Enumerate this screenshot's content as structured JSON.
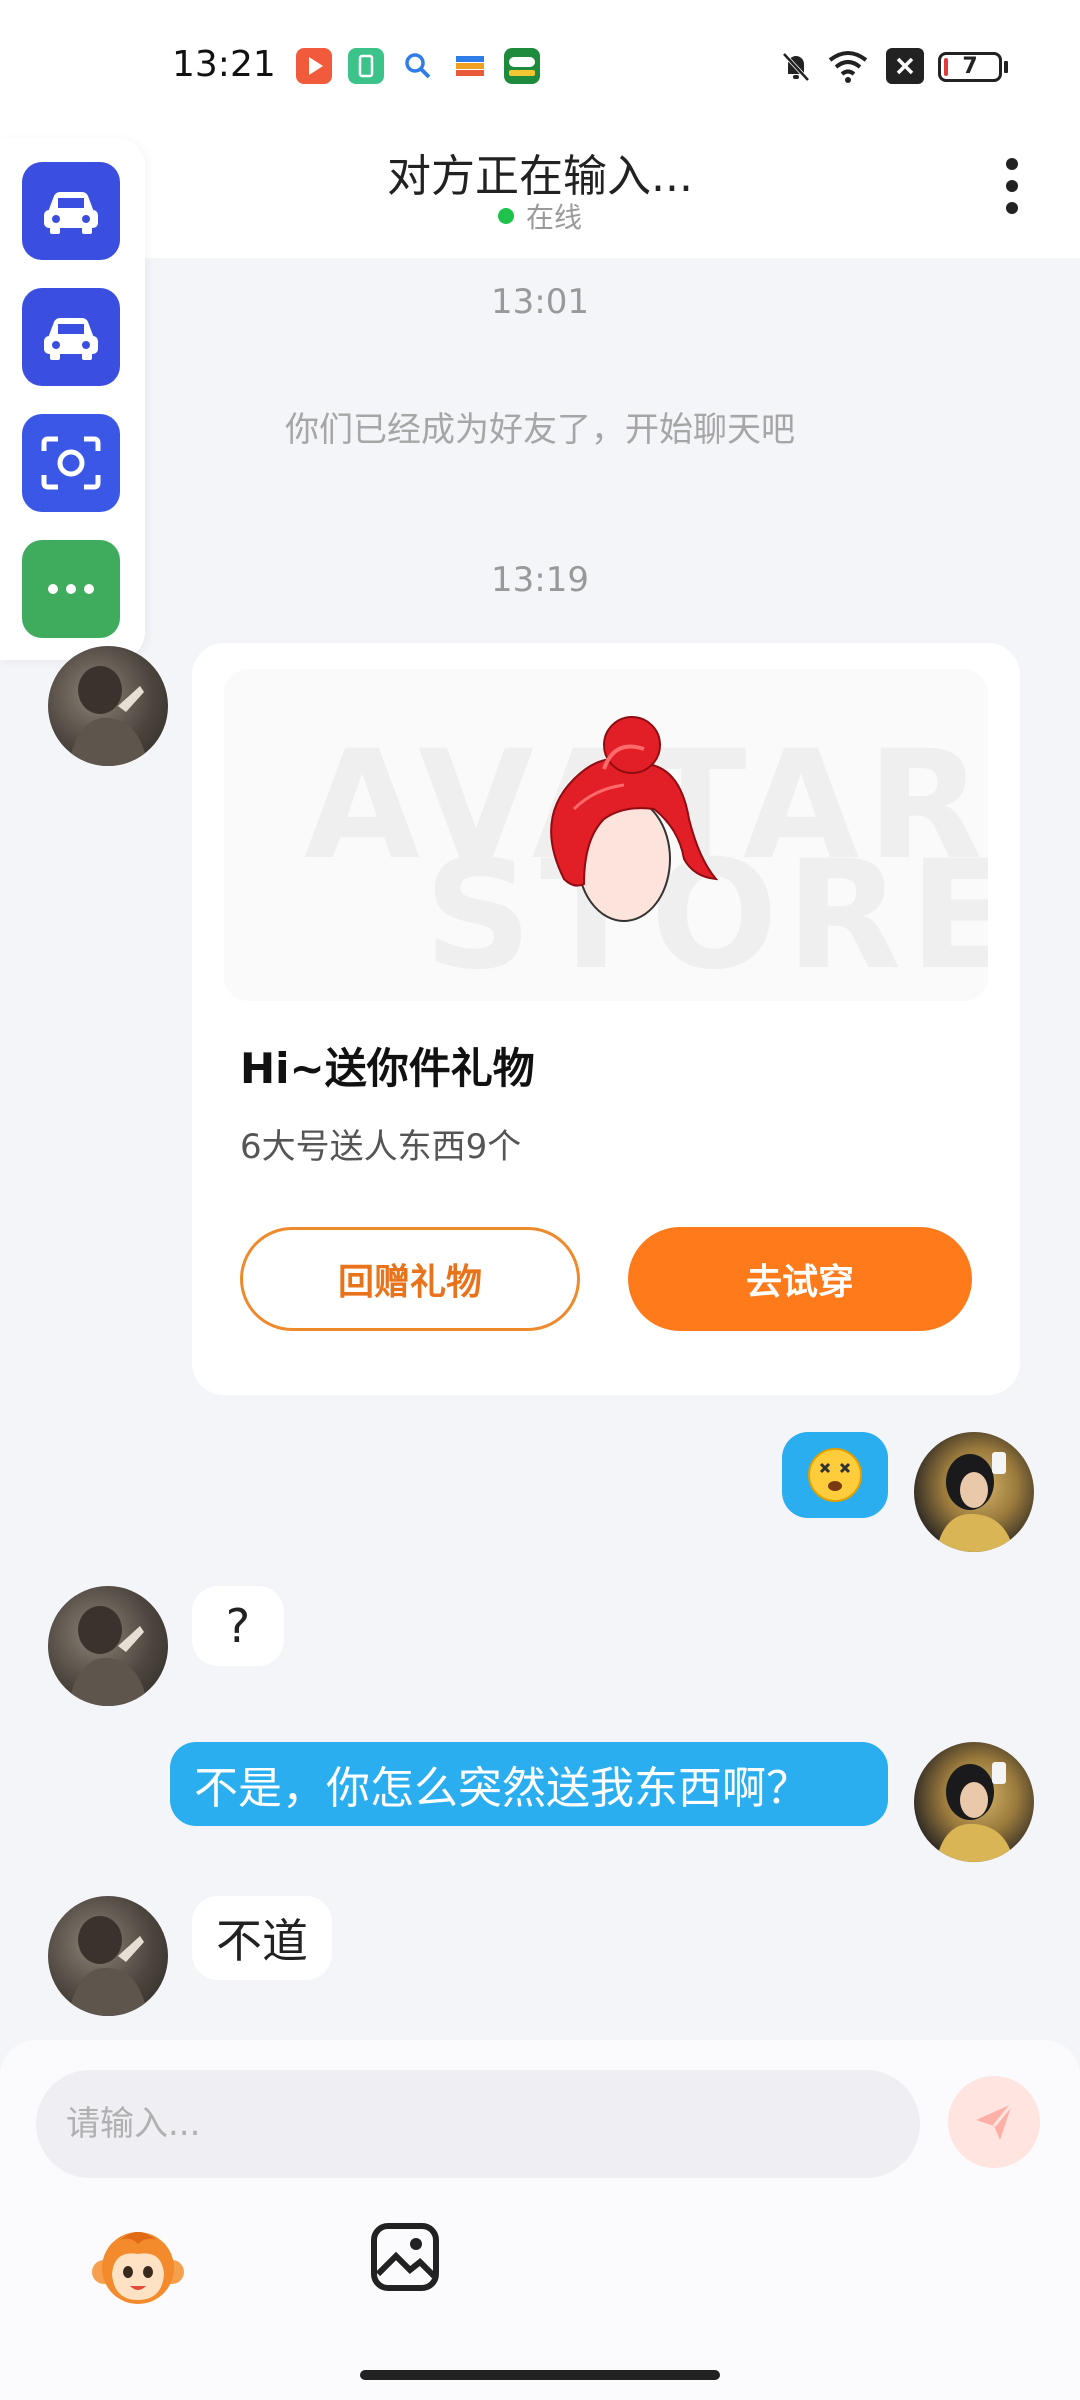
{
  "status_bar": {
    "time": "13:21",
    "battery": "7",
    "colors": {
      "app1": "#f25a3c",
      "app2": "#3cc38a",
      "app3": "#2f7ee8",
      "app4": "#f0a020",
      "app5": "#1e8a3c"
    }
  },
  "header": {
    "title": "对方正在输入...",
    "status": "在线"
  },
  "side_panel": {
    "buttons": [
      {
        "icon": "car-icon",
        "color": "#3a4fe0"
      },
      {
        "icon": "car-icon",
        "color": "#3a4fe0"
      },
      {
        "icon": "scan-icon",
        "color": "#3a57e6"
      },
      {
        "icon": "more-dots-icon",
        "color": "#3fab5c"
      }
    ]
  },
  "chat": {
    "timestamp_1": "13:01",
    "system_message": "你们已经成为好友了，开始聊天吧",
    "timestamp_2": "13:19",
    "gift_card": {
      "watermark_1": "AVATAR",
      "watermark_2": "STORE",
      "title": "Hi~送你件礼物",
      "subtitle": "6大号送人东西9个",
      "return_button": "回赠礼物",
      "try_button": "去试穿"
    },
    "messages": [
      {
        "side": "right",
        "type": "emoji",
        "icon": "dizzy-face-icon"
      },
      {
        "side": "left",
        "text": "?"
      },
      {
        "side": "right",
        "text": "不是，你怎么突然送我东西啊？"
      },
      {
        "side": "left",
        "text": "不道"
      }
    ]
  },
  "input_bar": {
    "placeholder": "请输入...",
    "tools": [
      "monkey-sticker-icon",
      "image-icon"
    ],
    "send_color": "#ff7a6a"
  }
}
